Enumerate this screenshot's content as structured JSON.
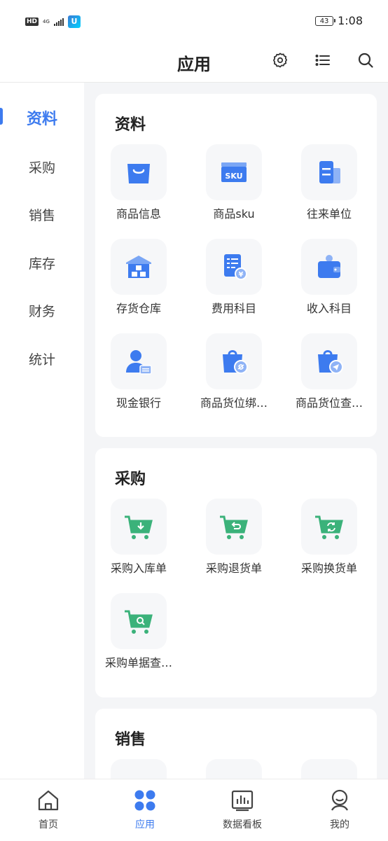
{
  "status_bar": {
    "left_badge": "HD",
    "network": "4G",
    "app_badge": "U",
    "battery": "43",
    "time": "1:08"
  },
  "header": {
    "title": "应用"
  },
  "sidebar": {
    "items": [
      {
        "label": "资料",
        "active": true
      },
      {
        "label": "采购"
      },
      {
        "label": "销售"
      },
      {
        "label": "库存"
      },
      {
        "label": "财务"
      },
      {
        "label": "统计"
      }
    ]
  },
  "sections": [
    {
      "title": "资料",
      "items": [
        {
          "label": "商品信息",
          "icon": "shopping-bag-icon"
        },
        {
          "label": "商品sku",
          "icon": "sku-box-icon",
          "badge": "SKU"
        },
        {
          "label": "往来单位",
          "icon": "building-icon"
        },
        {
          "label": "存货仓库",
          "icon": "warehouse-icon"
        },
        {
          "label": "费用科目",
          "icon": "expense-doc-icon"
        },
        {
          "label": "收入科目",
          "icon": "wallet-icon"
        },
        {
          "label": "现金银行",
          "icon": "person-card-icon"
        },
        {
          "label": "商品货位绑…",
          "icon": "bag-link-icon"
        },
        {
          "label": "商品货位查…",
          "icon": "bag-send-icon"
        }
      ]
    },
    {
      "title": "采购",
      "items": [
        {
          "label": "采购入库单",
          "icon": "cart-in-icon"
        },
        {
          "label": "采购退货单",
          "icon": "cart-return-icon"
        },
        {
          "label": "采购换货单",
          "icon": "cart-exchange-icon"
        },
        {
          "label": "采购单据查…",
          "icon": "cart-search-icon"
        }
      ]
    },
    {
      "title": "销售",
      "items": []
    }
  ],
  "bottom_nav": [
    {
      "label": "首页",
      "icon": "home-icon"
    },
    {
      "label": "应用",
      "icon": "apps-icon",
      "active": true
    },
    {
      "label": "数据看板",
      "icon": "dashboard-icon"
    },
    {
      "label": "我的",
      "icon": "profile-icon"
    }
  ],
  "colors": {
    "accent": "#3d7bef",
    "green": "#3bb27a",
    "orange": "#f4a94e"
  }
}
